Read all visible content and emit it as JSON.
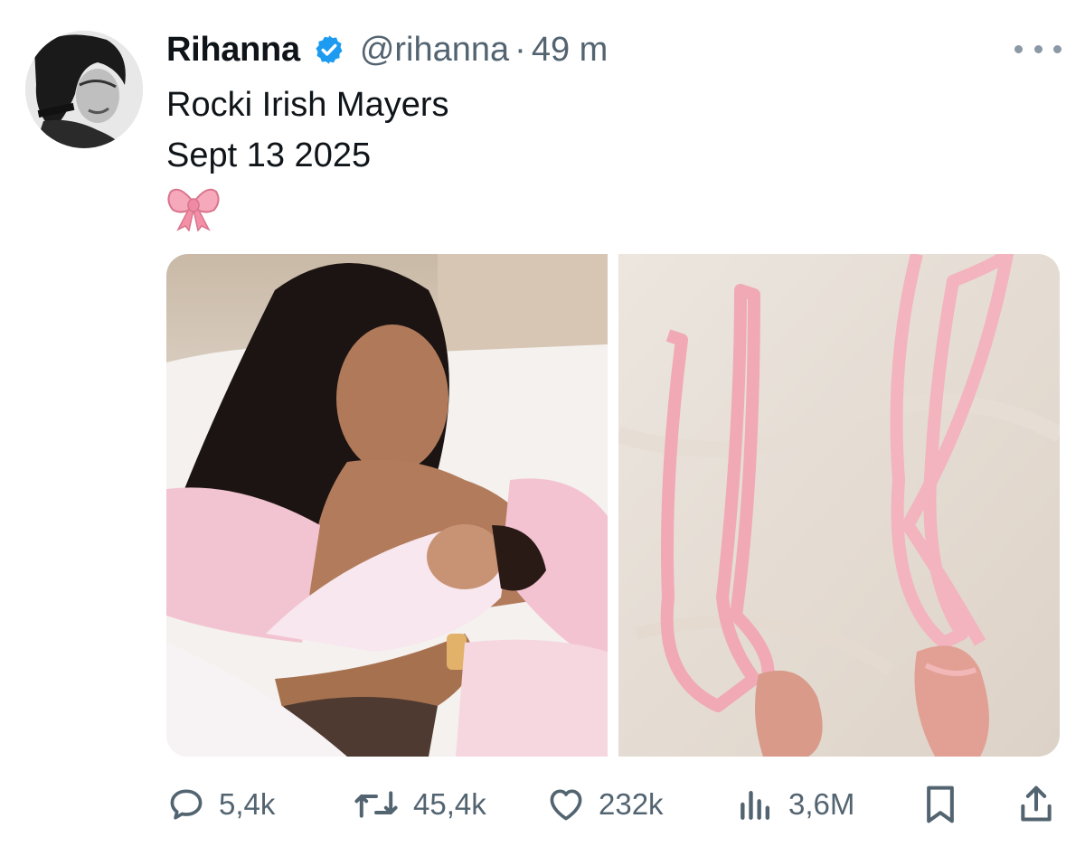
{
  "colors": {
    "text_primary": "#0f1419",
    "text_secondary": "#536471",
    "verified_blue": "#1d9bf0",
    "icon_gray": "#536471",
    "ribbon_pink": "#f1a7b4"
  },
  "author": {
    "name": "Rihanna",
    "handle": "@rihanna",
    "separator": "·",
    "time": "49 m",
    "avatar_icon": "profile-avatar",
    "badge_icon": "verified-badge-icon"
  },
  "tweet": {
    "lines": [
      "Rocki Irish Mayers",
      "Sept 13 2025"
    ],
    "emoji_icon": "pink-bow-emoji"
  },
  "media": {
    "photos": [
      {
        "description_icon": "photo-mother-holding-newborn"
      },
      {
        "description_icon": "photo-pink-ribbon-baby-shoes"
      }
    ]
  },
  "actions": {
    "reply": {
      "icon": "reply-icon",
      "count": "5,4k"
    },
    "repost": {
      "icon": "repost-icon",
      "count": "45,4k"
    },
    "like": {
      "icon": "heart-icon",
      "count": "232k"
    },
    "views": {
      "icon": "views-icon",
      "count": "3,6M"
    },
    "bookmark": {
      "icon": "bookmark-icon"
    },
    "share": {
      "icon": "share-icon"
    }
  }
}
